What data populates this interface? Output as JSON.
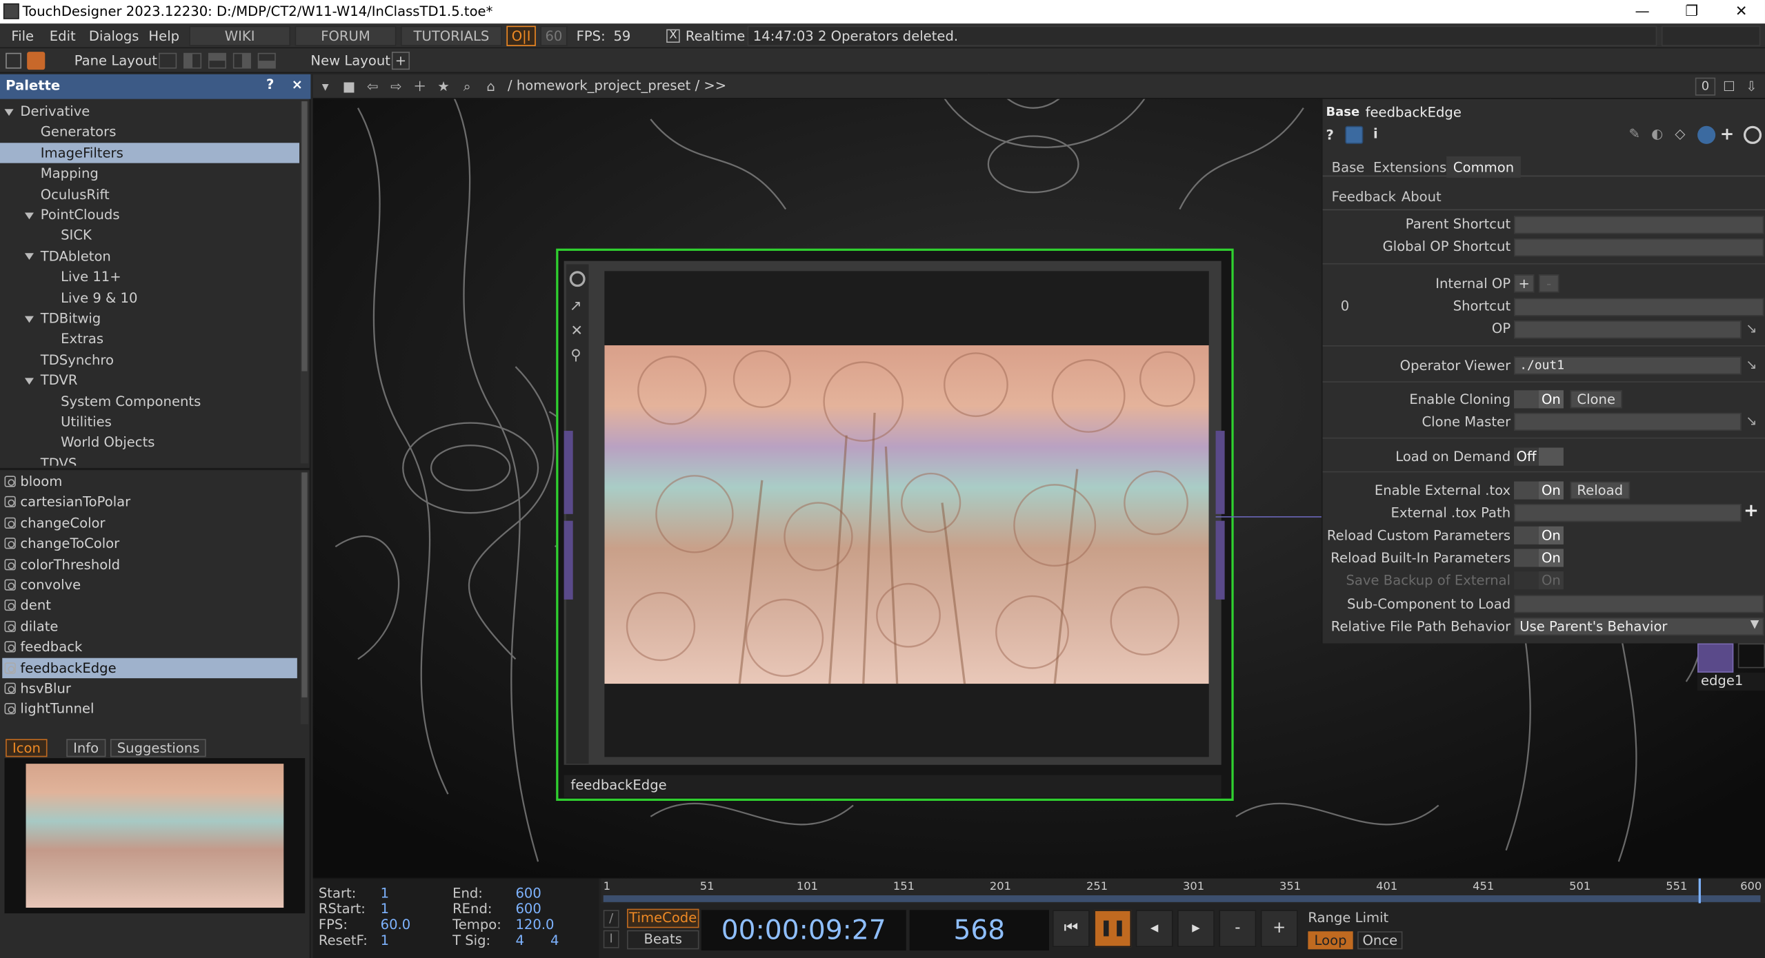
{
  "window": {
    "title": "TouchDesigner 2023.12230: D:/MDP/CT2/W11-W14/InClassTD1.5.toe*",
    "minimize": "—",
    "maximize": "❐",
    "close": "✕"
  },
  "menu": {
    "items": [
      "File",
      "Edit",
      "Dialogs",
      "Help"
    ],
    "wiki": "WIKI",
    "forum": "FORUM",
    "tutorials": "TUTORIALS",
    "oi": "O|I",
    "fps_target": "60",
    "fps_label": "FPS:",
    "fps_value": "59",
    "realtime_check": "X",
    "realtime": "Realtime",
    "status": "14:47:03 2 Operators deleted."
  },
  "toolbar": {
    "pane_layout": "Pane Layout",
    "new_layout": "New Layout",
    "plus": "+"
  },
  "palette": {
    "title": "Palette",
    "help": "?",
    "close": "×",
    "tree": [
      {
        "label": "Derivative",
        "level": 0,
        "expanded": true
      },
      {
        "label": "Generators",
        "level": 1
      },
      {
        "label": "ImageFilters",
        "level": 1,
        "selected": true
      },
      {
        "label": "Mapping",
        "level": 1
      },
      {
        "label": "OculusRift",
        "level": 1
      },
      {
        "label": "PointClouds",
        "level": 1,
        "expanded": true
      },
      {
        "label": "SICK",
        "level": 2
      },
      {
        "label": "TDAbleton",
        "level": 1,
        "expanded": true
      },
      {
        "label": "Live 11+",
        "level": 2
      },
      {
        "label": "Live 9 & 10",
        "level": 2
      },
      {
        "label": "TDBitwig",
        "level": 1,
        "expanded": true
      },
      {
        "label": "Extras",
        "level": 2
      },
      {
        "label": "TDSynchro",
        "level": 1
      },
      {
        "label": "TDVR",
        "level": 1,
        "expanded": true
      },
      {
        "label": "System Components",
        "level": 2
      },
      {
        "label": "Utilities",
        "level": 2
      },
      {
        "label": "World Objects",
        "level": 2
      },
      {
        "label": "TDVS",
        "level": 1
      }
    ],
    "components": [
      "bloom",
      "cartesianToPolar",
      "changeColor",
      "changeToColor",
      "colorThreshold",
      "convolve",
      "dent",
      "dilate",
      "feedback",
      "feedbackEdge",
      "hsvBlur",
      "lightTunnel"
    ],
    "selected_component": "feedbackEdge",
    "tabs": [
      "Icon",
      "Info",
      "Suggestions"
    ],
    "active_tab": "Icon"
  },
  "network": {
    "path": "/ homework_project_preset / >>",
    "zero": "0",
    "node_label": "feedbackEdge",
    "side_node": "edge1"
  },
  "params": {
    "type": "Base",
    "name": "feedbackEdge",
    "tabs": [
      "Base",
      "Extensions",
      "Common"
    ],
    "active_tab": "Common",
    "subtabs": [
      "Feedback",
      "About"
    ],
    "parent_shortcut": "Parent Shortcut",
    "global_op_shortcut": "Global OP Shortcut",
    "internal_op": "Internal OP",
    "index_zero": "0",
    "shortcut": "Shortcut",
    "op": "OP",
    "operator_viewer": "Operator Viewer",
    "operator_viewer_value": "./out1",
    "enable_cloning": "Enable Cloning",
    "on": "On",
    "off": "Off",
    "clone_btn": "Clone",
    "clone_master": "Clone Master",
    "load_on_demand": "Load on Demand",
    "enable_external_tox": "Enable External .tox",
    "reload_btn": "Reload",
    "external_tox_path": "External .tox Path",
    "reload_custom": "Reload Custom Parameters",
    "reload_builtin": "Reload Built-In Parameters",
    "save_backup": "Save Backup of External",
    "sub_component": "Sub-Component to Load",
    "relative_path": "Relative File Path Behavior",
    "relative_path_value": "Use Parent's Behavior"
  },
  "timeline": {
    "start_label": "Start:",
    "start": "1",
    "end_label": "End:",
    "end": "600",
    "rstart_label": "RStart:",
    "rstart": "1",
    "rend_label": "REnd:",
    "rend": "600",
    "fps_label": "FPS:",
    "fps": "60.0",
    "tempo_label": "Tempo:",
    "tempo": "120.0",
    "resetf_label": "ResetF:",
    "resetf": "1",
    "tsig_label": "T Sig:",
    "tsig_a": "4",
    "tsig_b": "4",
    "ticks": [
      "1",
      "51",
      "101",
      "151",
      "201",
      "251",
      "301",
      "351",
      "401",
      "451",
      "501",
      "551",
      "600"
    ],
    "timecode_btn": "TimeCode",
    "beats_btn": "Beats",
    "timecode": "00:00:09:27",
    "frame": "568",
    "range_limit": "Range Limit",
    "loop": "Loop",
    "once": "Once",
    "playhead": 568,
    "range": [
      1,
      600
    ]
  }
}
